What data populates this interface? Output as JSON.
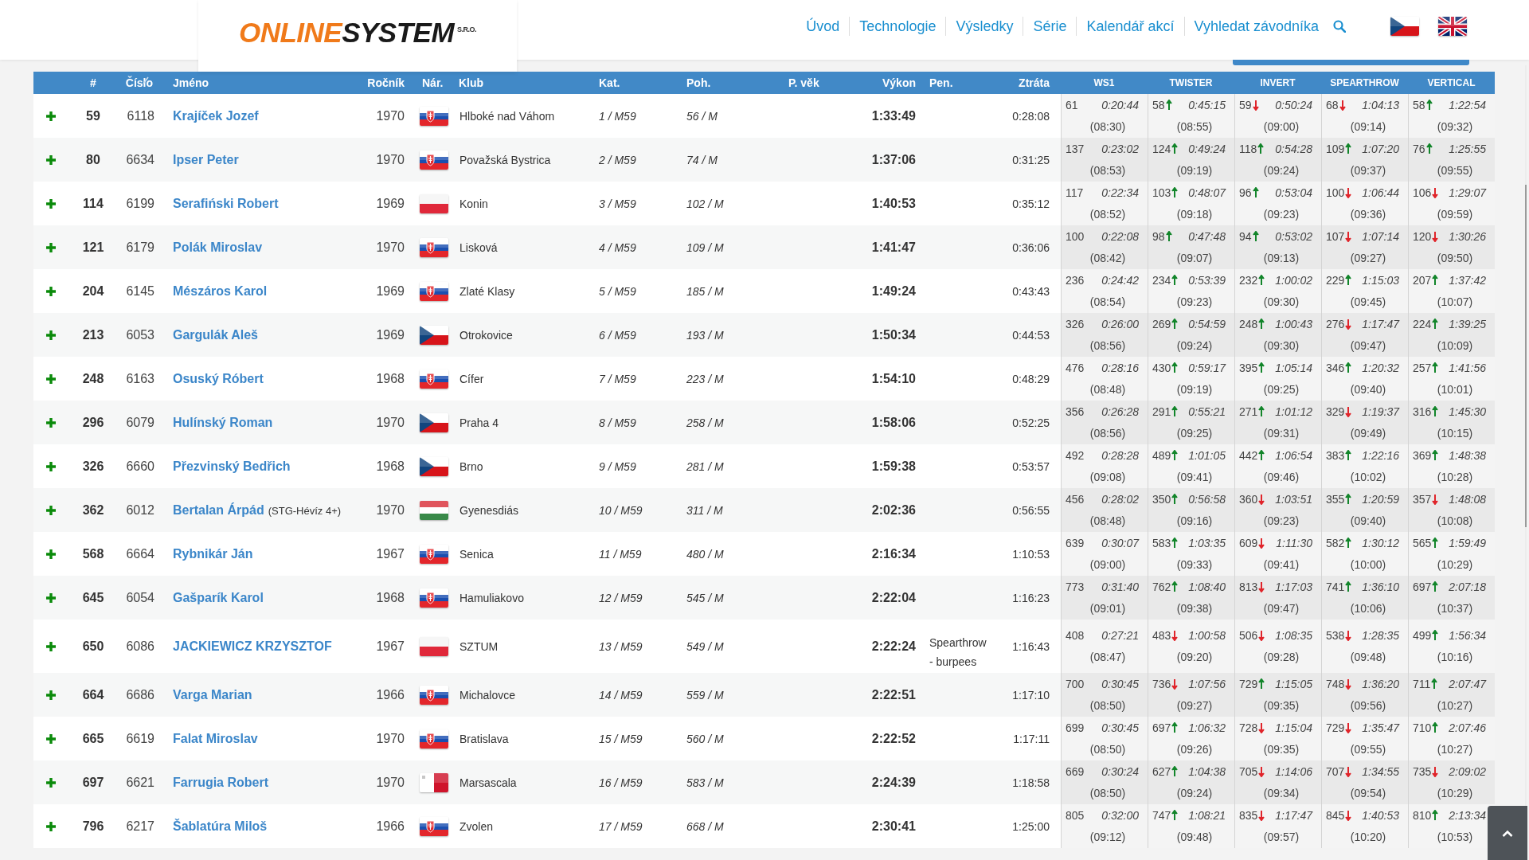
{
  "logo": {
    "part1": "ONLINE",
    "part2": "SYSTEM",
    "suffix": "S.R.O."
  },
  "nav": [
    "Úvod",
    "Technologie",
    "Výsledky",
    "Série",
    "Kalendář akcí",
    "Vyhledat závodníka"
  ],
  "languages": [
    {
      "kind": "cz",
      "selected": false
    },
    {
      "kind": "gb",
      "selected": false
    }
  ],
  "table": {
    "columns": [
      "#",
      "Číslo",
      "Jméno",
      "Ročník",
      "Nár.",
      "Klub",
      "Kat.",
      "Poh.",
      "P. věk",
      "Výkon",
      "Pen.",
      "Ztráta"
    ],
    "split_columns": [
      "WS1",
      "TWISTER",
      "INVERT",
      "SPEARTHROW",
      "VERTICAL"
    ],
    "rows": [
      {
        "rank": "59",
        "number": "6118",
        "name": "Krajíček Jozef",
        "year": "1970",
        "flag": {
          "kind": "sk"
        },
        "club": "Hlboké nad Váhom",
        "category": "1 / M59",
        "gender": "56 / M",
        "result": "1:33:49",
        "loss": "0:28:08",
        "splits": [
          {
            "rank": "61",
            "time": "0:20:44",
            "pace": "(08:30)"
          },
          {
            "rank": "58",
            "improved": true,
            "time": "0:45:15",
            "pace": "(08:55)"
          },
          {
            "rank": "59",
            "improved": false,
            "time": "0:50:24",
            "pace": "(09:00)"
          },
          {
            "rank": "68",
            "improved": false,
            "time": "1:04:13",
            "pace": "(09:14)"
          },
          {
            "rank": "58",
            "improved": true,
            "time": "1:22:54",
            "pace": "(09:32)"
          }
        ]
      },
      {
        "rank": "80",
        "number": "6634",
        "name": "Ipser Peter",
        "year": "1970",
        "flag": {
          "kind": "sk"
        },
        "club": "Považská Bystrica",
        "category": "2 / M59",
        "gender": "74 / M",
        "result": "1:37:06",
        "loss": "0:31:25",
        "splits": [
          {
            "rank": "137",
            "time": "0:23:02",
            "pace": "(08:53)"
          },
          {
            "rank": "124",
            "improved": true,
            "time": "0:49:24",
            "pace": "(09:19)"
          },
          {
            "rank": "118",
            "improved": true,
            "time": "0:54:28",
            "pace": "(09:24)"
          },
          {
            "rank": "109",
            "improved": true,
            "time": "1:07:20",
            "pace": "(09:37)"
          },
          {
            "rank": "76",
            "improved": true,
            "time": "1:25:55",
            "pace": "(09:55)"
          }
        ]
      },
      {
        "rank": "114",
        "number": "6199",
        "name": "Serafiński Robert",
        "year": "1969",
        "flag": {
          "kind": "pl"
        },
        "club": "Konin",
        "category": "3 / M59",
        "gender": "102 / M",
        "result": "1:40:53",
        "loss": "0:35:12",
        "splits": [
          {
            "rank": "117",
            "time": "0:22:34",
            "pace": "(08:52)"
          },
          {
            "rank": "103",
            "improved": true,
            "time": "0:48:07",
            "pace": "(09:18)"
          },
          {
            "rank": "96",
            "improved": true,
            "time": "0:53:04",
            "pace": "(09:23)"
          },
          {
            "rank": "100",
            "improved": false,
            "time": "1:06:44",
            "pace": "(09:36)"
          },
          {
            "rank": "106",
            "improved": false,
            "time": "1:29:07",
            "pace": "(09:59)"
          }
        ]
      },
      {
        "rank": "121",
        "number": "6179",
        "name": "Polák Miroslav",
        "year": "1970",
        "flag": {
          "kind": "sk"
        },
        "club": "Lisková",
        "category": "4 / M59",
        "gender": "109 / M",
        "result": "1:41:47",
        "loss": "0:36:06",
        "splits": [
          {
            "rank": "100",
            "time": "0:22:08",
            "pace": "(08:42)"
          },
          {
            "rank": "98",
            "improved": true,
            "time": "0:47:48",
            "pace": "(09:07)"
          },
          {
            "rank": "94",
            "improved": true,
            "time": "0:53:02",
            "pace": "(09:13)"
          },
          {
            "rank": "107",
            "improved": false,
            "time": "1:07:14",
            "pace": "(09:27)"
          },
          {
            "rank": "120",
            "improved": false,
            "time": "1:30:26",
            "pace": "(09:50)"
          }
        ]
      },
      {
        "rank": "204",
        "number": "6145",
        "name": "Mészáros Karol",
        "year": "1969",
        "flag": {
          "kind": "sk"
        },
        "club": "Zlaté Klasy",
        "category": "5 / M59",
        "gender": "185 / M",
        "result": "1:49:24",
        "loss": "0:43:43",
        "splits": [
          {
            "rank": "236",
            "time": "0:24:42",
            "pace": "(08:54)"
          },
          {
            "rank": "234",
            "improved": true,
            "time": "0:53:39",
            "pace": "(09:23)"
          },
          {
            "rank": "232",
            "improved": true,
            "time": "1:00:02",
            "pace": "(09:30)"
          },
          {
            "rank": "229",
            "improved": true,
            "time": "1:15:03",
            "pace": "(09:45)"
          },
          {
            "rank": "207",
            "improved": true,
            "time": "1:37:42",
            "pace": "(10:07)"
          }
        ]
      },
      {
        "rank": "213",
        "number": "6053",
        "name": "Gargulák Aleš",
        "year": "1969",
        "flag": {
          "kind": "cz"
        },
        "club": "Otrokovice",
        "category": "6 / M59",
        "gender": "193 / M",
        "result": "1:50:34",
        "loss": "0:44:53",
        "splits": [
          {
            "rank": "326",
            "time": "0:26:00",
            "pace": "(08:56)"
          },
          {
            "rank": "269",
            "improved": true,
            "time": "0:54:59",
            "pace": "(09:24)"
          },
          {
            "rank": "248",
            "improved": true,
            "time": "1:00:43",
            "pace": "(09:30)"
          },
          {
            "rank": "276",
            "improved": false,
            "time": "1:17:47",
            "pace": "(09:47)"
          },
          {
            "rank": "224",
            "improved": true,
            "time": "1:39:25",
            "pace": "(10:09)"
          }
        ]
      },
      {
        "rank": "248",
        "number": "6163",
        "name": "Osuský Róbert",
        "year": "1968",
        "flag": {
          "kind": "sk"
        },
        "club": "Cífer",
        "category": "7 / M59",
        "gender": "223 / M",
        "result": "1:54:10",
        "loss": "0:48:29",
        "splits": [
          {
            "rank": "476",
            "time": "0:28:16",
            "pace": "(08:48)"
          },
          {
            "rank": "430",
            "improved": true,
            "time": "0:59:17",
            "pace": "(09:19)"
          },
          {
            "rank": "395",
            "improved": true,
            "time": "1:05:14",
            "pace": "(09:25)"
          },
          {
            "rank": "346",
            "improved": true,
            "time": "1:20:32",
            "pace": "(09:40)"
          },
          {
            "rank": "257",
            "improved": true,
            "time": "1:41:56",
            "pace": "(10:01)"
          }
        ]
      },
      {
        "rank": "296",
        "number": "6079",
        "name": "Hulínský Roman",
        "year": "1970",
        "flag": {
          "kind": "cz"
        },
        "club": "Praha 4",
        "category": "8 / M59",
        "gender": "258 / M",
        "result": "1:58:06",
        "loss": "0:52:25",
        "splits": [
          {
            "rank": "356",
            "time": "0:26:28",
            "pace": "(08:56)"
          },
          {
            "rank": "291",
            "improved": true,
            "time": "0:55:21",
            "pace": "(09:25)"
          },
          {
            "rank": "271",
            "improved": true,
            "time": "1:01:12",
            "pace": "(09:31)"
          },
          {
            "rank": "329",
            "improved": false,
            "time": "1:19:37",
            "pace": "(09:49)"
          },
          {
            "rank": "316",
            "improved": true,
            "time": "1:45:30",
            "pace": "(10:15)"
          }
        ]
      },
      {
        "rank": "326",
        "number": "6660",
        "name": "Přezvinský Bedřich",
        "year": "1968",
        "flag": {
          "kind": "cz"
        },
        "club": "Brno",
        "category": "9 / M59",
        "gender": "281 / M",
        "result": "1:59:38",
        "loss": "0:53:57",
        "splits": [
          {
            "rank": "492",
            "time": "0:28:28",
            "pace": "(09:08)"
          },
          {
            "rank": "489",
            "improved": true,
            "time": "1:01:05",
            "pace": "(09:41)"
          },
          {
            "rank": "442",
            "improved": true,
            "time": "1:06:54",
            "pace": "(09:46)"
          },
          {
            "rank": "383",
            "improved": true,
            "time": "1:22:16",
            "pace": "(10:02)"
          },
          {
            "rank": "369",
            "improved": true,
            "time": "1:48:38",
            "pace": "(10:28)"
          }
        ]
      },
      {
        "rank": "362",
        "number": "6012",
        "name": "Bertalan Árpád",
        "team": "(STG-Hévíz 4+)",
        "year": "1970",
        "flag": {
          "kind": "hu"
        },
        "club": "Gyenesdiás",
        "category": "10 / M59",
        "gender": "311 / M",
        "result": "2:02:36",
        "loss": "0:56:55",
        "splits": [
          {
            "rank": "456",
            "time": "0:28:02",
            "pace": "(08:48)"
          },
          {
            "rank": "350",
            "improved": true,
            "time": "0:56:58",
            "pace": "(09:16)"
          },
          {
            "rank": "360",
            "improved": false,
            "time": "1:03:51",
            "pace": "(09:23)"
          },
          {
            "rank": "355",
            "improved": true,
            "time": "1:20:59",
            "pace": "(09:40)"
          },
          {
            "rank": "357",
            "improved": false,
            "time": "1:48:08",
            "pace": "(10:08)"
          }
        ]
      },
      {
        "rank": "568",
        "number": "6664",
        "name": "Rybnikár Ján",
        "year": "1967",
        "flag": {
          "kind": "sk"
        },
        "club": "Senica",
        "category": "11 / M59",
        "gender": "480 / M",
        "result": "2:16:34",
        "loss": "1:10:53",
        "splits": [
          {
            "rank": "639",
            "time": "0:30:07",
            "pace": "(09:00)"
          },
          {
            "rank": "583",
            "improved": true,
            "time": "1:03:35",
            "pace": "(09:33)"
          },
          {
            "rank": "609",
            "improved": false,
            "time": "1:11:30",
            "pace": "(09:41)"
          },
          {
            "rank": "582",
            "improved": true,
            "time": "1:30:12",
            "pace": "(10:00)"
          },
          {
            "rank": "565",
            "improved": true,
            "time": "1:59:49",
            "pace": "(10:29)"
          }
        ]
      },
      {
        "rank": "645",
        "number": "6054",
        "name": "Gašparík Karol",
        "year": "1968",
        "flag": {
          "kind": "sk"
        },
        "club": "Hamuliakovo",
        "category": "12 / M59",
        "gender": "545 / M",
        "result": "2:22:04",
        "loss": "1:16:23",
        "splits": [
          {
            "rank": "773",
            "time": "0:31:40",
            "pace": "(09:01)"
          },
          {
            "rank": "762",
            "improved": true,
            "time": "1:08:40",
            "pace": "(09:38)"
          },
          {
            "rank": "813",
            "improved": false,
            "time": "1:17:03",
            "pace": "(09:47)"
          },
          {
            "rank": "741",
            "improved": true,
            "time": "1:36:10",
            "pace": "(10:06)"
          },
          {
            "rank": "697",
            "improved": true,
            "time": "2:07:18",
            "pace": "(10:37)"
          }
        ]
      },
      {
        "rank": "650",
        "number": "6086",
        "name": "JACKIEWICZ KRZYSZTOF",
        "year": "1967",
        "flag": {
          "kind": "pl"
        },
        "club": "SZTUM",
        "category": "13 / M59",
        "gender": "549 / M",
        "result": "2:22:24",
        "penalty": "Spearthrow - burpees",
        "loss": "1:16:43",
        "splits": [
          {
            "rank": "408",
            "time": "0:27:21",
            "pace": "(08:47)"
          },
          {
            "rank": "483",
            "improved": false,
            "time": "1:00:58",
            "pace": "(09:20)"
          },
          {
            "rank": "506",
            "improved": false,
            "time": "1:08:35",
            "pace": "(09:28)"
          },
          {
            "rank": "538",
            "improved": false,
            "time": "1:28:35",
            "pace": "(09:48)"
          },
          {
            "rank": "499",
            "improved": true,
            "time": "1:56:34",
            "pace": "(10:16)"
          }
        ]
      },
      {
        "rank": "664",
        "number": "6686",
        "name": "Varga Marian",
        "year": "1966",
        "flag": {
          "kind": "sk"
        },
        "club": "Michalovce",
        "category": "14 / M59",
        "gender": "559 / M",
        "result": "2:22:51",
        "loss": "1:17:10",
        "splits": [
          {
            "rank": "700",
            "time": "0:30:45",
            "pace": "(08:50)"
          },
          {
            "rank": "736",
            "improved": false,
            "time": "1:07:56",
            "pace": "(09:27)"
          },
          {
            "rank": "729",
            "improved": true,
            "time": "1:15:05",
            "pace": "(09:35)"
          },
          {
            "rank": "748",
            "improved": false,
            "time": "1:36:20",
            "pace": "(09:56)"
          },
          {
            "rank": "711",
            "improved": true,
            "time": "2:07:47",
            "pace": "(10:27)"
          }
        ]
      },
      {
        "rank": "665",
        "number": "6619",
        "name": "Falat Miroslav",
        "year": "1970",
        "flag": {
          "kind": "sk"
        },
        "club": "Bratislava",
        "category": "15 / M59",
        "gender": "560 / M",
        "result": "2:22:52",
        "loss": "1:17:11",
        "splits": [
          {
            "rank": "699",
            "time": "0:30:45",
            "pace": "(08:50)"
          },
          {
            "rank": "697",
            "improved": true,
            "time": "1:06:32",
            "pace": "(09:26)"
          },
          {
            "rank": "728",
            "improved": false,
            "time": "1:15:04",
            "pace": "(09:35)"
          },
          {
            "rank": "729",
            "improved": false,
            "time": "1:35:47",
            "pace": "(09:55)"
          },
          {
            "rank": "710",
            "improved": true,
            "time": "2:07:46",
            "pace": "(10:27)"
          }
        ]
      },
      {
        "rank": "697",
        "number": "6621",
        "name": "Farrugia Robert",
        "year": "1970",
        "flag": {
          "kind": "mt"
        },
        "club": "Marsascala",
        "category": "16 / M59",
        "gender": "583 / M",
        "result": "2:24:39",
        "loss": "1:18:58",
        "splits": [
          {
            "rank": "669",
            "time": "0:30:24",
            "pace": "(08:50)"
          },
          {
            "rank": "627",
            "improved": true,
            "time": "1:04:38",
            "pace": "(09:24)"
          },
          {
            "rank": "705",
            "improved": false,
            "time": "1:14:06",
            "pace": "(09:34)"
          },
          {
            "rank": "707",
            "improved": false,
            "time": "1:34:55",
            "pace": "(09:54)"
          },
          {
            "rank": "735",
            "improved": false,
            "time": "2:09:02",
            "pace": "(10:29)"
          }
        ]
      },
      {
        "rank": "796",
        "number": "6217",
        "name": "Šablatúra Miloš",
        "year": "1966",
        "flag": {
          "kind": "sk"
        },
        "club": "Zvolen",
        "category": "17 / M59",
        "gender": "668 / M",
        "result": "2:30:41",
        "loss": "1:25:00",
        "splits": [
          {
            "rank": "805",
            "time": "0:32:00",
            "pace": "(09:12)"
          },
          {
            "rank": "747",
            "improved": true,
            "time": "1:08:21",
            "pace": "(09:48)"
          },
          {
            "rank": "835",
            "improved": false,
            "time": "1:17:47",
            "pace": "(09:57)"
          },
          {
            "rank": "845",
            "improved": false,
            "time": "1:40:53",
            "pace": "(10:20)"
          },
          {
            "rank": "810",
            "improved": true,
            "time": "2:13:34",
            "pace": "(10:53)"
          }
        ]
      }
    ]
  }
}
